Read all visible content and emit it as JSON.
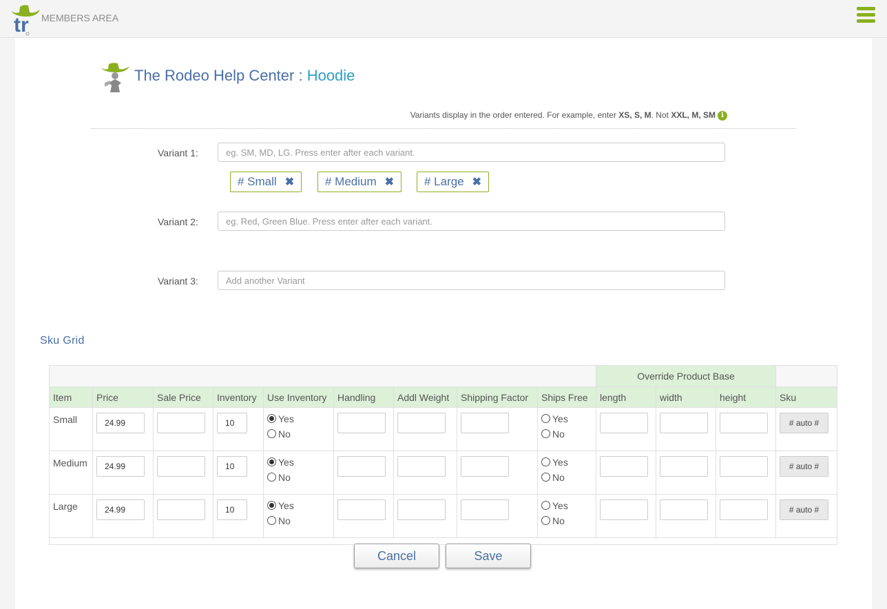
{
  "header": {
    "logo_text": "tr",
    "members_label": "MEMBERS AREA",
    "menu_icon": "hamburger-menu-icon"
  },
  "page": {
    "title": "The Rodeo Help Center",
    "separator": " : ",
    "product": "Hoodie"
  },
  "hint": {
    "prefix": "Variants display in the order entered. For example, enter ",
    "good": "XS, S, M",
    "middle": ". Not ",
    "bad": "XXL, M, SM",
    "icon": "info-icon"
  },
  "variants": [
    {
      "label": "Variant 1:",
      "placeholder": "eg. SM, MD, LG. Press enter after each variant."
    },
    {
      "label": "Variant 2:",
      "placeholder": "eg. Red, Green Blue. Press enter after each variant."
    },
    {
      "label": "Variant 3:",
      "placeholder": "Add another Variant"
    }
  ],
  "tags": [
    "# Small",
    "# Medium",
    "# Large"
  ],
  "sku_grid": {
    "heading": "Sku Grid",
    "override_label": "Override Product Base",
    "columns": [
      "Item",
      "Price",
      "Sale Price",
      "Inventory",
      "Use Inventory",
      "Handling",
      "Addl Weight",
      "Shipping Factor",
      "Ships Free",
      "length",
      "width",
      "height",
      "Sku"
    ],
    "yes": "Yes",
    "no": "No",
    "sku_button": "# auto #",
    "rows": [
      {
        "item": "Small",
        "price": "24.99",
        "inventory": "10",
        "use_inventory": "Yes",
        "ships_free": ""
      },
      {
        "item": "Medium",
        "price": "24.99",
        "inventory": "10",
        "use_inventory": "Yes",
        "ships_free": ""
      },
      {
        "item": "Large",
        "price": "24.99",
        "inventory": "10",
        "use_inventory": "Yes",
        "ships_free": ""
      }
    ]
  },
  "actions": {
    "cancel": "Cancel",
    "save": "Save"
  },
  "colors": {
    "accent_green": "#8ab020",
    "link_blue": "#4a6fa5",
    "title_accent": "#2e9fc4",
    "header_green": "#ddf0d8"
  }
}
